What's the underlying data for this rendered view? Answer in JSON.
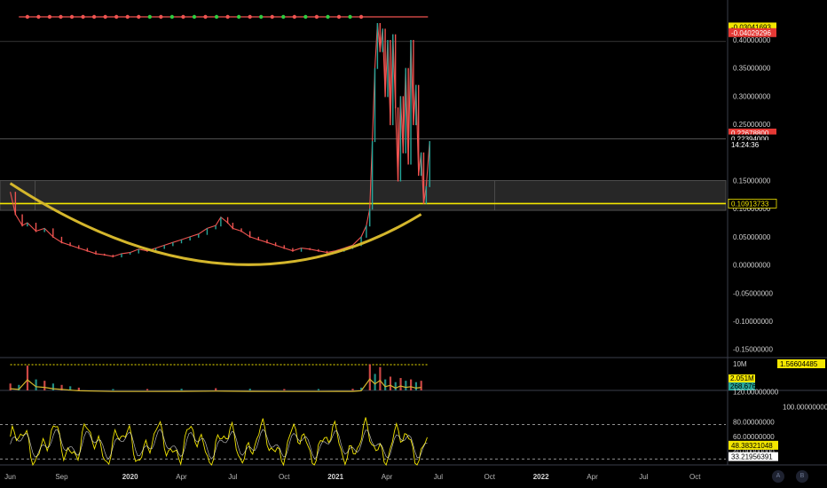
{
  "chart_data": {
    "type": "line",
    "title": "",
    "price_axis": {
      "range": [
        -0.16,
        0.43
      ],
      "ticks": [
        "0.40000000",
        "0.35000000",
        "0.30000000",
        "0.25000000",
        "0.15000000",
        "0.10000000",
        "0.05000000",
        "0.00000000",
        "-0.05000000",
        "-0.10000000",
        "-0.15000000"
      ],
      "tick_values": [
        0.4,
        0.35,
        0.3,
        0.25,
        0.15,
        0.1,
        0.05,
        0.0,
        -0.05,
        -0.1,
        -0.15
      ]
    },
    "x_axis": {
      "labels": [
        "Jun",
        "Sep",
        "2020",
        "Apr",
        "Jul",
        "Oct",
        "2021",
        "Apr",
        "Jul",
        "Oct",
        "2022",
        "Apr",
        "Jul",
        "Oct"
      ],
      "bold_labels": [
        "2020",
        "2021",
        "2022"
      ],
      "label_months": [
        0,
        3,
        7,
        10,
        13,
        16,
        19,
        22,
        25,
        28,
        31,
        34,
        37,
        40
      ],
      "range_months": [
        -0.6,
        41.8
      ]
    },
    "price_series": {
      "name": "",
      "x_months": [
        0,
        0.3,
        0.7,
        1,
        1.5,
        2,
        2.5,
        3,
        3.5,
        4,
        4.5,
        5,
        5.5,
        6,
        6.5,
        7,
        7.5,
        8,
        8.5,
        9,
        9.5,
        10,
        10.5,
        11,
        11.5,
        12,
        12.3,
        12.7,
        13,
        13.5,
        14,
        14.5,
        15,
        15.5,
        16,
        16.5,
        17,
        17.5,
        18,
        18.5,
        19,
        19.5,
        20,
        20.5,
        20.8,
        21,
        21.15,
        21.3,
        21.45,
        21.6,
        21.75,
        21.9,
        22.05,
        22.2,
        22.35,
        22.5,
        22.65,
        22.8,
        22.95,
        23.1,
        23.25,
        23.4,
        23.55,
        23.7,
        23.85,
        24,
        24.15,
        24.3,
        24.5
      ],
      "values": [
        0.13,
        0.09,
        0.07,
        0.075,
        0.06,
        0.065,
        0.05,
        0.04,
        0.035,
        0.03,
        0.025,
        0.02,
        0.018,
        0.015,
        0.02,
        0.022,
        0.028,
        0.025,
        0.03,
        0.035,
        0.04,
        0.045,
        0.05,
        0.055,
        0.065,
        0.07,
        0.085,
        0.075,
        0.065,
        0.06,
        0.05,
        0.045,
        0.04,
        0.035,
        0.03,
        0.025,
        0.03,
        0.028,
        0.025,
        0.022,
        0.025,
        0.03,
        0.035,
        0.05,
        0.07,
        0.1,
        0.22,
        0.35,
        0.43,
        0.38,
        0.42,
        0.3,
        0.4,
        0.25,
        0.41,
        0.28,
        0.15,
        0.3,
        0.2,
        0.35,
        0.18,
        0.4,
        0.25,
        0.32,
        0.16,
        0.2,
        0.11,
        0.14,
        0.22
      ]
    },
    "cup_curve": {
      "x_months": [
        0,
        6.5,
        13,
        19,
        24
      ],
      "values": [
        0.145,
        0.01,
        -0.003,
        0.03,
        0.09
      ]
    },
    "zone": {
      "low": 0.097,
      "high": 0.15,
      "x_start_month": -0.6
    },
    "support_line": {
      "value": 0.1091
    },
    "current_price_line": {
      "value": 0.2239
    },
    "price_labels": [
      {
        "text": "-0.03041693",
        "value": 0.423,
        "bg": "#f3e600",
        "fg": "#000000"
      },
      {
        "text": "-0.04029296",
        "value": 0.413,
        "bg": "#e53935",
        "fg": "#ffffff"
      },
      {
        "text": "0.22678800",
        "value": 0.2345,
        "bg": "#e53935",
        "fg": "#ffffff"
      },
      {
        "text": "0.22394000",
        "value": 0.224,
        "bg": "#000000",
        "fg": "#ffffff"
      },
      {
        "text": "14:24:36",
        "value": 0.214,
        "bg": "#000000",
        "fg": "#ffffff"
      },
      {
        "text": "0.10913733",
        "value": 0.1091,
        "bg": "#000000",
        "fg": "#f3e600",
        "border": "#f3e600"
      }
    ],
    "volume_panel": {
      "max_label": "10M",
      "value_label": "2.051M",
      "second_label": "268.676K",
      "right_label": "1.56604485",
      "x_months": [
        0,
        0.5,
        1,
        1.5,
        2,
        2.5,
        3,
        3.5,
        4,
        6,
        8,
        10,
        12,
        14,
        16,
        18,
        20,
        20.5,
        21,
        21.3,
        21.6,
        21.9,
        22.2,
        22.5,
        22.8,
        23.1,
        23.4,
        23.7,
        24
      ],
      "values": [
        0.25,
        0.2,
        0.9,
        0.4,
        0.35,
        0.25,
        0.2,
        0.15,
        0.1,
        0.05,
        0.05,
        0.06,
        0.08,
        0.06,
        0.05,
        0.05,
        0.06,
        0.1,
        0.95,
        0.6,
        0.85,
        0.4,
        0.5,
        0.3,
        0.45,
        0.35,
        0.4,
        0.3,
        0.35
      ]
    },
    "oscillator_panel": {
      "ticks": [
        "120.00000000",
        "100.00000000",
        "80.00000000",
        "60.00000000",
        "40.00000000"
      ],
      "tick_values": [
        120,
        100,
        80,
        60,
        40
      ],
      "range": [
        22,
        122
      ],
      "upper_level": 76,
      "lower_level": 30,
      "value_label": "48.38321048",
      "second_label": "33.21956391"
    },
    "toolbar_buttons": [
      "A",
      "B"
    ],
    "colors": {
      "up": "#26a69a",
      "down": "#ef5350",
      "accent": "#f3e600",
      "cup": "#d4b62c",
      "zone": "#2b2b2b",
      "grid": "#2a2e39"
    }
  }
}
